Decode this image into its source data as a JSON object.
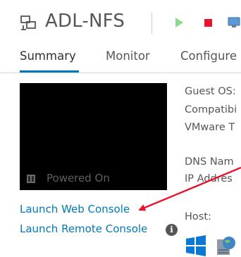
{
  "header": {
    "vm_name": "ADL-NFS",
    "actions": [
      "play-icon",
      "stop-icon",
      "console-icon"
    ],
    "colors": {
      "play": "#8fd88f",
      "stop": "#e8132c"
    }
  },
  "tabs": [
    {
      "label": "Summary",
      "active": true
    },
    {
      "label": "Monitor"
    },
    {
      "label": "Configure"
    }
  ],
  "console": {
    "status": "Powered On",
    "launch_web": "Launch Web Console",
    "launch_remote": "Launch Remote Console",
    "info_glyph": "i"
  },
  "properties": {
    "guest_os": "Guest OS:",
    "compat": "Compatibi",
    "vmware": "VMware T",
    "dns": "DNS Nam",
    "ip": "IP Addres",
    "host": "Host:"
  },
  "annotation": {
    "arrow_color": "#e8132c"
  },
  "accent_color": "#0079b8"
}
